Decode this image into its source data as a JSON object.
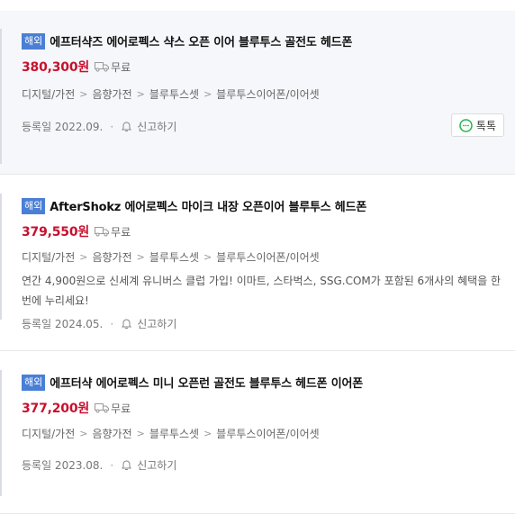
{
  "listings": [
    {
      "badge": "해외",
      "title": "에프터샥즈 에어로펙스 샥스 오픈 이어 블루투스 골전도 헤드폰",
      "price": "380,300원",
      "shipping": "무료",
      "categories": [
        "디지털/가전",
        "음향가전",
        "블루투스셋",
        "블루투스이어폰/이어셋"
      ],
      "registered": "등록일 2022.09.",
      "report": "신고하기",
      "talk": "톡톡"
    },
    {
      "badge": "해외",
      "title": "AfterShokz 에어로펙스 마이크 내장 오픈이어 블루투스 헤드폰",
      "price": "379,550원",
      "shipping": "무료",
      "categories": [
        "디지털/가전",
        "음향가전",
        "블루투스셋",
        "블루투스이어폰/이어셋"
      ],
      "description": "연간 4,900원으로 신세계 유니버스 클럽 가입! 이마트, 스타벅스, SSG.COM가 포함된 6개사의 혜택을 한 번에 누리세요!",
      "registered": "등록일 2024.05.",
      "report": "신고하기"
    },
    {
      "badge": "해외",
      "title": "에프터샥 에어로펙스 미니 오픈런 골전도 블루투스 헤드폰 이어폰",
      "price": "377,200원",
      "shipping": "무료",
      "categories": [
        "디지털/가전",
        "음향가전",
        "블루투스셋",
        "블루투스이어폰/이어셋"
      ],
      "registered": "등록일 2023.08.",
      "report": "신고하기"
    }
  ],
  "colors": {
    "price": "#c8102e",
    "badge": "#4a7fd6",
    "highlight_bg": "#f5f7fa",
    "talk_green": "#1fb64a"
  }
}
